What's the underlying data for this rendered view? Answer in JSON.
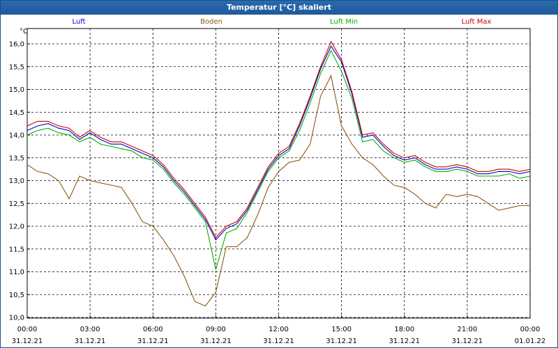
{
  "window": {
    "title": "Temperatur [°C] skaliert"
  },
  "chart_data": {
    "type": "line",
    "ylabel": "°C",
    "ylim": [
      10.0,
      16.0
    ],
    "y_ticks": [
      "10,0",
      "10,5",
      "11,0",
      "11,5",
      "12,0",
      "12,5",
      "13,0",
      "13,5",
      "14,0",
      "14,5",
      "15,0",
      "15,5",
      "16,0"
    ],
    "xlim": [
      0,
      24
    ],
    "x_ticks": [
      {
        "time": "00:00",
        "date": "31.12.21"
      },
      {
        "time": "03:00",
        "date": "31.12.21"
      },
      {
        "time": "06:00",
        "date": "31.12.21"
      },
      {
        "time": "09:00",
        "date": "31.12.21"
      },
      {
        "time": "12:00",
        "date": "31.12.21"
      },
      {
        "time": "15:00",
        "date": "31.12.21"
      },
      {
        "time": "18:00",
        "date": "31.12.21"
      },
      {
        "time": "21:00",
        "date": "31.12.21"
      },
      {
        "time": "00:00",
        "date": "01.01.22"
      }
    ],
    "grid": true,
    "legend_position": "top",
    "x": [
      0,
      0.5,
      1,
      1.5,
      2,
      2.5,
      3,
      3.5,
      4,
      4.5,
      5,
      5.5,
      6,
      6.5,
      7,
      7.5,
      8,
      8.5,
      9,
      9.5,
      10,
      10.5,
      11,
      11.5,
      12,
      12.5,
      13,
      13.5,
      14,
      14.5,
      15,
      15.5,
      16,
      16.5,
      17,
      17.5,
      18,
      18.5,
      19,
      19.5,
      20,
      20.5,
      21,
      21.5,
      22,
      22.5,
      23,
      23.5,
      24
    ],
    "series": [
      {
        "name": "Luft",
        "color": "#0000cc",
        "values": [
          14.1,
          14.2,
          14.25,
          14.15,
          14.1,
          13.9,
          14.05,
          13.9,
          13.8,
          13.8,
          13.7,
          13.6,
          13.5,
          13.3,
          13.0,
          12.75,
          12.45,
          12.15,
          11.7,
          11.95,
          12.05,
          12.35,
          12.8,
          13.25,
          13.55,
          13.7,
          14.2,
          14.8,
          15.45,
          15.95,
          15.6,
          14.9,
          13.95,
          14.0,
          13.75,
          13.55,
          13.45,
          13.5,
          13.35,
          13.25,
          13.25,
          13.3,
          13.25,
          13.15,
          13.15,
          13.2,
          13.2,
          13.15,
          13.2
        ]
      },
      {
        "name": "Boden",
        "color": "#8b5a10",
        "values": [
          13.35,
          13.2,
          13.15,
          13.0,
          12.6,
          13.1,
          13.0,
          12.95,
          12.9,
          12.85,
          12.5,
          12.1,
          12.0,
          11.7,
          11.35,
          10.9,
          10.35,
          10.25,
          10.55,
          11.55,
          11.55,
          11.75,
          12.25,
          12.85,
          13.2,
          13.4,
          13.45,
          13.8,
          14.85,
          15.3,
          14.2,
          13.8,
          13.5,
          13.35,
          13.1,
          12.9,
          12.85,
          12.7,
          12.5,
          12.4,
          12.7,
          12.65,
          12.7,
          12.65,
          12.5,
          12.35,
          12.4,
          12.45,
          12.45
        ]
      },
      {
        "name": "Luft Min",
        "color": "#00b000",
        "values": [
          14.0,
          14.1,
          14.15,
          14.05,
          14.0,
          13.85,
          13.95,
          13.8,
          13.75,
          13.7,
          13.65,
          13.5,
          13.45,
          13.25,
          12.95,
          12.7,
          12.4,
          12.1,
          11.05,
          11.85,
          11.95,
          12.3,
          12.75,
          13.2,
          13.5,
          13.65,
          14.1,
          14.7,
          15.35,
          15.85,
          15.4,
          14.8,
          13.85,
          13.9,
          13.65,
          13.5,
          13.4,
          13.45,
          13.3,
          13.2,
          13.2,
          13.25,
          13.2,
          13.1,
          13.1,
          13.1,
          13.15,
          13.05,
          13.1
        ]
      },
      {
        "name": "Luft Max",
        "color": "#cc0000",
        "values": [
          14.2,
          14.3,
          14.3,
          14.2,
          14.15,
          13.95,
          14.1,
          13.95,
          13.85,
          13.85,
          13.75,
          13.65,
          13.55,
          13.35,
          13.05,
          12.8,
          12.5,
          12.2,
          11.75,
          12.0,
          12.1,
          12.4,
          12.85,
          13.3,
          13.6,
          13.75,
          14.25,
          14.85,
          15.5,
          16.05,
          15.65,
          14.95,
          14.0,
          14.05,
          13.8,
          13.6,
          13.5,
          13.55,
          13.4,
          13.3,
          13.3,
          13.35,
          13.3,
          13.2,
          13.2,
          13.25,
          13.25,
          13.2,
          13.25
        ]
      }
    ]
  }
}
